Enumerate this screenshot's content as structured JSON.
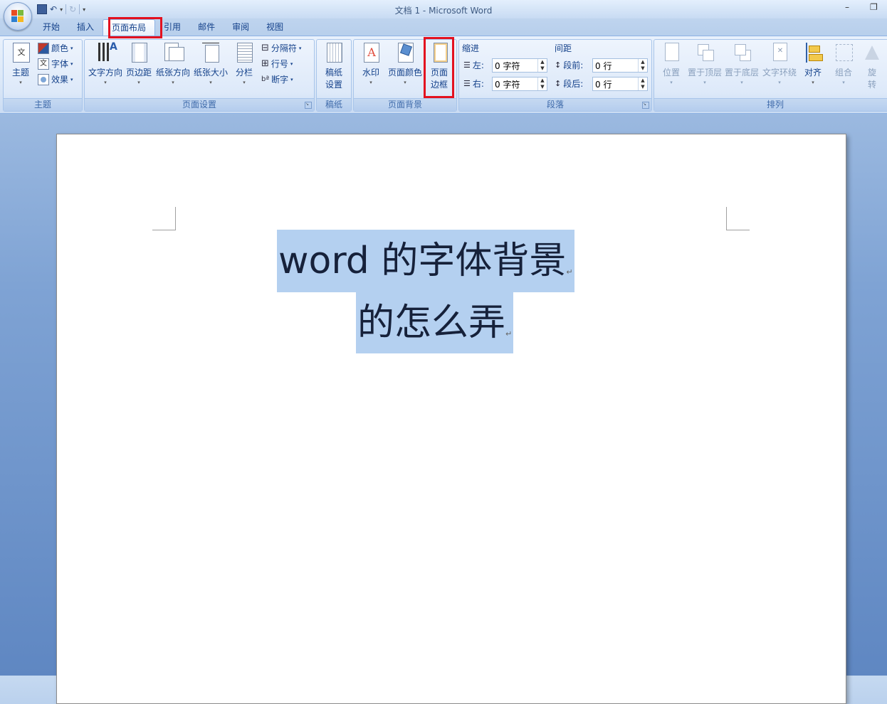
{
  "window": {
    "title": "文档 1 - Microsoft Word",
    "minimize": "–",
    "restore": "❐"
  },
  "tabs": [
    "开始",
    "插入",
    "页面布局",
    "引用",
    "邮件",
    "审阅",
    "视图"
  ],
  "active_tab": "页面布局",
  "ribbon": {
    "theme": {
      "themes": "主题",
      "colors": "颜色",
      "fonts": "字体",
      "effects": "效果",
      "label": "主题"
    },
    "page_setup": {
      "text_direction": "文字方向",
      "margins": "页边距",
      "orientation": "纸张方向",
      "size": "纸张大小",
      "columns": "分栏",
      "breaks": "分隔符",
      "line_numbers": "行号",
      "hyphenation": "断字",
      "label": "页面设置"
    },
    "manuscript": {
      "settings_line1": "稿纸",
      "settings_line2": "设置",
      "label": "稿纸"
    },
    "page_background": {
      "watermark": "水印",
      "page_color": "页面颜色",
      "borders_line1": "页面",
      "borders_line2": "边框",
      "label": "页面背景"
    },
    "paragraph": {
      "indent_title": "缩进",
      "left_label": "左:",
      "left_value": "0 字符",
      "right_label": "右:",
      "right_value": "0 字符",
      "spacing_title": "间距",
      "before_label": "段前:",
      "before_value": "0 行",
      "after_label": "段后:",
      "after_value": "0 行",
      "label": "段落"
    },
    "arrange": {
      "position": "位置",
      "bring_front": "置于顶层",
      "send_back": "置于底层",
      "text_wrap": "文字环绕",
      "align": "对齐",
      "group": "组合",
      "rotate_line1": "旋",
      "rotate_line2": "转",
      "label": "排列"
    }
  },
  "document": {
    "line1_latin": "word ",
    "line1_cjk": "的字体背景",
    "line2": "的怎么弄",
    "paragraph_mark": "↵"
  },
  "colors": {
    "highlight": "#b4d0f0",
    "annotation_red": "#e3111f",
    "ribbon_text": "#15428b"
  }
}
